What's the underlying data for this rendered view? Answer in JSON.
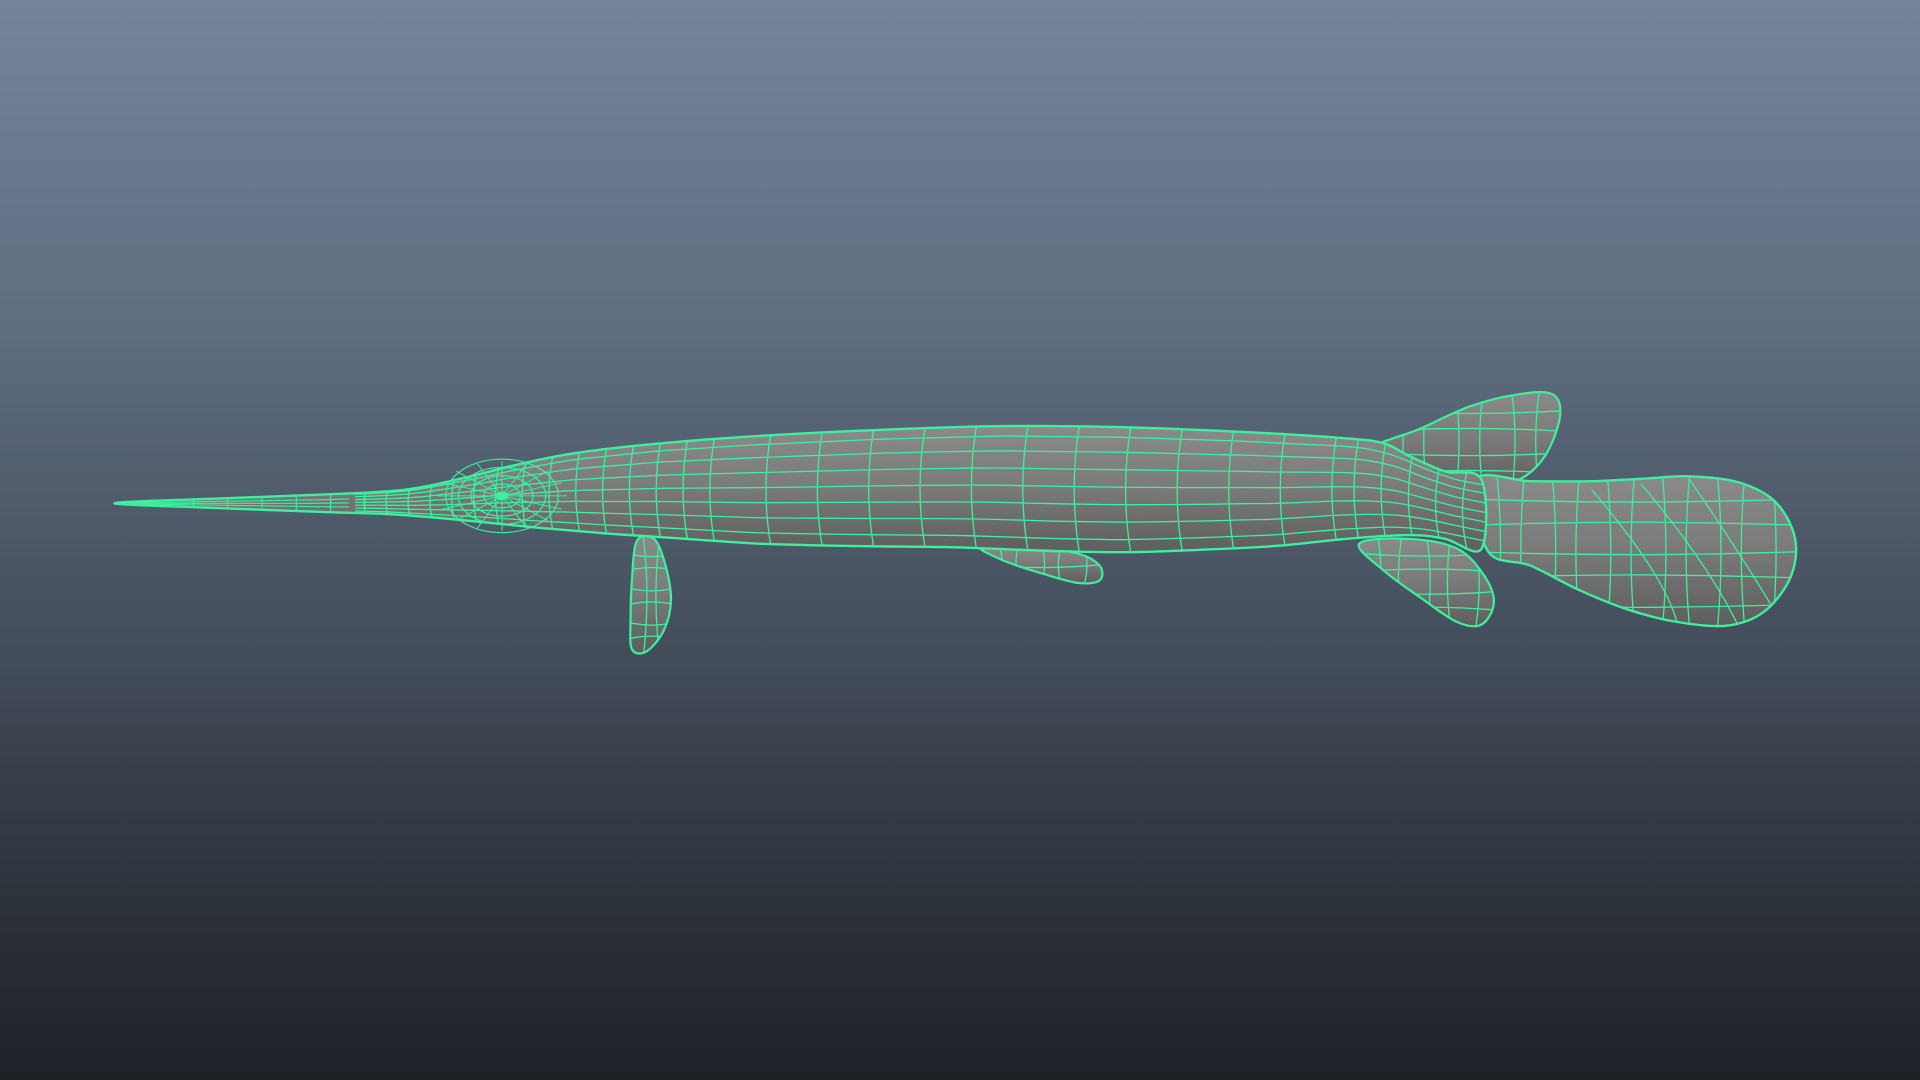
{
  "viewport": {
    "background_top": "#74849a",
    "background_bottom": "#1e2126"
  },
  "model": {
    "subject": "fish-wireframe",
    "display_mode": "wireframe-on-shaded",
    "surface_color": "#7c7c7c",
    "wire_color": "#3cf0a0"
  }
}
